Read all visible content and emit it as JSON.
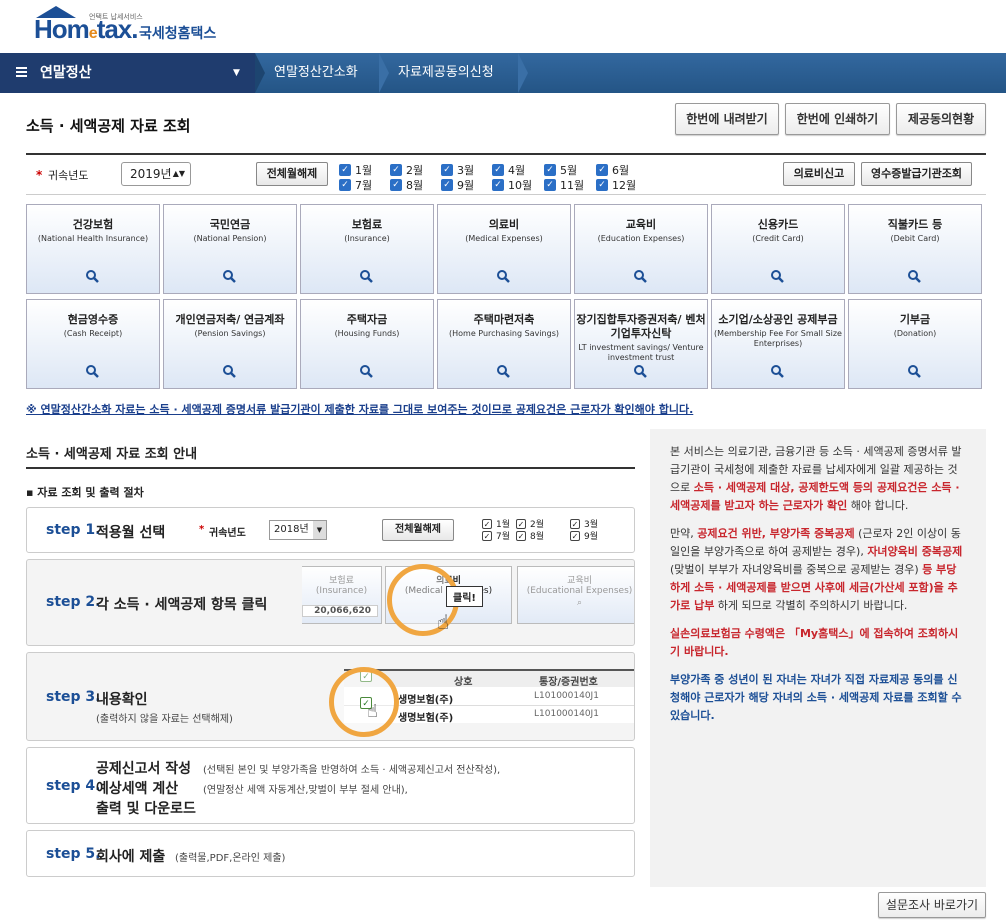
{
  "header": {
    "logo_main": "Hometax",
    "logo_sub": "언택트 납세서비스",
    "logo_name": "국세청홈택스"
  },
  "nav": {
    "menu": "연말정산",
    "crumb1": "연말정산간소화",
    "crumb2": "자료제공동의신청"
  },
  "page": {
    "title": "소득 · 세액공제 자료 조회",
    "btn_download": "한번에 내려받기",
    "btn_print": "한번에 인쇄하기",
    "btn_consent": "제공동의현황"
  },
  "filter": {
    "label": "귀속년도",
    "year": "2019년",
    "clear_btn": "전체월해제",
    "months_top": [
      "1월",
      "2월",
      "3월",
      "4월",
      "5월",
      "6월"
    ],
    "months_bottom": [
      "7월",
      "8월",
      "9월",
      "10월",
      "11월",
      "12월"
    ],
    "medical_btn": "의료비신고",
    "receipt_btn": "영수증발급기관조회"
  },
  "tiles": [
    {
      "t": "건강보험",
      "e": "(National Health Insurance)"
    },
    {
      "t": "국민연금",
      "e": "(National Pension)"
    },
    {
      "t": "보험료",
      "e": "(Insurance)"
    },
    {
      "t": "의료비",
      "e": "(Medical Expenses)"
    },
    {
      "t": "교육비",
      "e": "(Education Expenses)"
    },
    {
      "t": "신용카드",
      "e": "(Credit Card)"
    },
    {
      "t": "직불카드 등",
      "e": "(Debit Card)"
    },
    {
      "t": "현금영수증",
      "e": "(Cash Receipt)"
    },
    {
      "t": "개인연금저축/ 연금계좌",
      "e": "(Pension Savings)"
    },
    {
      "t": "주택자금",
      "e": "(Housing Funds)"
    },
    {
      "t": "주택마련저축",
      "e": "(Home Purchasing Savings)"
    },
    {
      "t": "장기집합투자증권저축/ 벤처기업투자신탁",
      "e": "LT investment savings/ Venture investment trust"
    },
    {
      "t": "소기업/소상공인 공제부금",
      "e": "(Membership Fee For Small Size Enterprises)"
    },
    {
      "t": "기부금",
      "e": "(Donation)"
    }
  ],
  "notice": "※ 연말정산간소화 자료는 소득 · 세액공제 증명서류 발급기관이 제출한 자료를 그대로 보여주는 것이므로 공제요건은 근로자가 확인해야 합니다.",
  "guide": {
    "title": "소득 · 세액공제 자료 조회 안내",
    "sub": "자료 조회 및 출력 절차",
    "step1": {
      "n": "step 1.",
      "t": "적용월 선택",
      "label": "귀속년도",
      "year": "2018년",
      "btn": "전체월해제",
      "m": [
        "1월",
        "2월",
        "3월",
        "7월",
        "8월",
        "9월"
      ]
    },
    "step2": {
      "n": "step 2.",
      "t": "각 소득 · 세액공제 항목 클릭",
      "a": "보험료",
      "ae": "(Insurance)",
      "amount": "20,066,620",
      "b": "의료비",
      "be": "(Medical Expenses)",
      "c": "교육비",
      "ce": "(Educational Expenses)",
      "click": "클릭!"
    },
    "step3": {
      "n": "step 3.",
      "t": "내용확인",
      "s": "(출력하지 않을 자료는 선택해제)",
      "h1": "상호",
      "h2": "통장/증권번호",
      "r1": "생명보험(주)",
      "r1n": "L101000140J1",
      "r2": "생명보험(주)",
      "r2n": "L101000140J1"
    },
    "step4": {
      "n": "step 4.",
      "t1": "공제신고서 작성",
      "t2": "예상세액 계산",
      "t3": "출력 및 다운로드",
      "s1": "(선택된 본인 및 부양가족을 반영하여 소득 · 세액공제신고서 전산작성),",
      "s2": "(연말정산 세액 자동계산,맞벌이 부부 절세 안내),"
    },
    "step5": {
      "n": "step 5.",
      "t": "회사에 제출",
      "s": "(출력물,PDF,온라인 제출)"
    }
  },
  "panel": {
    "p1a": "본 서비스는 의료기관, 금융기관 등 소득 · 세액공제 증명서류 발급기관이 국세청에 제출한 자료를 납세자에게 일괄 제공하는 것으로 ",
    "p1b": "소득 · 세액공제 대상, 공제한도액 등의 공제요건은 소득 · 세액공제를 받고자 하는 근로자가 확인",
    "p1c": " 해야 합니다.",
    "p2a": "만약, ",
    "p2b": "공제요건 위반, 부양가족 중복공제",
    "p2c": " (근로자 2인 이상이 동일인을 부양가족으로 하여 공제받는 경우), ",
    "p2d": "자녀양육비 중복공제",
    "p2e": " (맞벌이 부부가 자녀양육비를 중복으로 공제받는 경우) ",
    "p2f": "등 부당하게 소득 · 세액공제를 받으면 사후에 세금(가산세 포함)을 추가로 납부",
    "p2g": " 하게 되므로 각별히 주의하시기 바랍니다.",
    "p3": "실손의료보험금 수령액은 「My홈택스」에 접속하여 조회하시기 바랍니다.",
    "p4": "부양가족 중 성년이 된 자녀는 자녀가 직접 자료제공 동의를 신청해야 근로자가 해당 자녀의 소득 · 세액공제 자료를 조회할 수 있습니다."
  },
  "survey_btn": "설문조사 바로가기"
}
